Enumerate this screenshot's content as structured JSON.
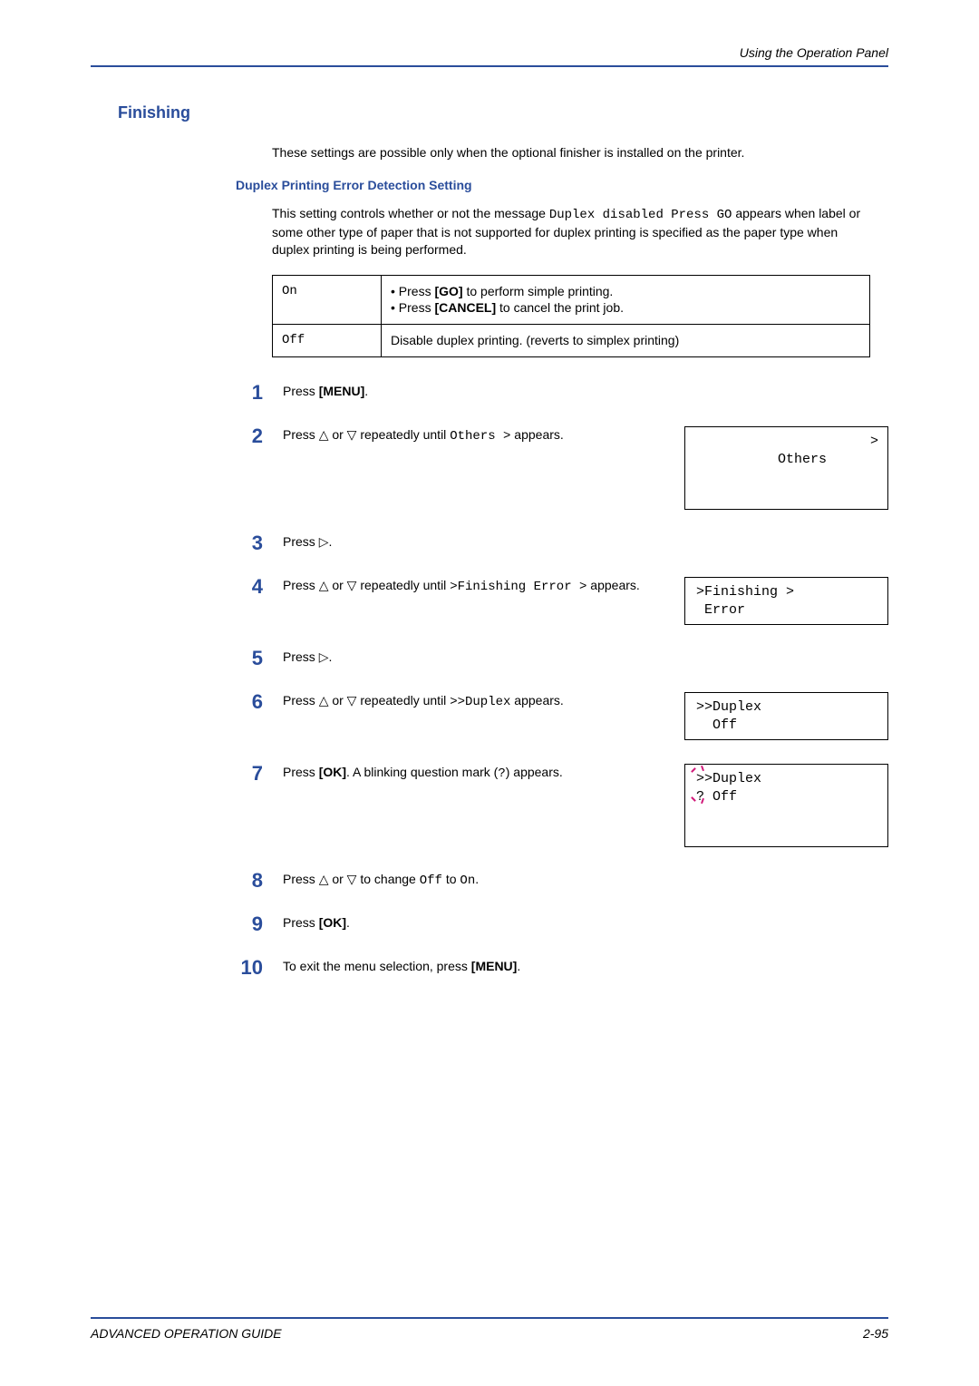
{
  "header": {
    "running": "Using the Operation Panel"
  },
  "title": "Finishing",
  "intro": "These settings are possible only when the optional finisher is installed on the printer.",
  "subsection": {
    "title": "Duplex Printing Error Detection Setting",
    "intro": {
      "pre": "This setting controls whether or not the message ",
      "code": "Duplex disabled Press GO",
      "post": " appears when label or some other type of paper that is not supported for duplex printing is specified as the paper type when duplex printing is being performed."
    }
  },
  "table": {
    "row1": {
      "key": "On",
      "b1": {
        "pre": "Press ",
        "bold": "[GO]",
        "post": " to perform simple printing."
      },
      "b2": {
        "pre": "Press ",
        "bold": "[CANCEL]",
        "post": " to cancel the print job."
      }
    },
    "row2": {
      "key": "Off",
      "text": "Disable duplex printing. (reverts to simplex printing)"
    }
  },
  "steps": {
    "s1": {
      "num": "1",
      "pre": "Press ",
      "bold": "[MENU]",
      "post": "."
    },
    "s2": {
      "num": "2",
      "pre": "Press ",
      "tri": "△ or ▽",
      "mid": " repeatedly until ",
      "code": "Others >",
      "post": " appears.",
      "lcd": {
        "line1": "Others",
        "arrow": ">"
      }
    },
    "s3": {
      "num": "3",
      "pre": "Press ",
      "tri": "▷",
      "post": "."
    },
    "s4": {
      "num": "4",
      "pre": "Press ",
      "tri": "△ or ▽",
      "mid": " repeatedly until ",
      "code": ">Finishing Error >",
      "post": " appears.",
      "lcd": {
        "line1": ">Finishing >",
        "line2": " Error"
      }
    },
    "s5": {
      "num": "5",
      "pre": "Press ",
      "tri": "▷",
      "post": "."
    },
    "s6": {
      "num": "6",
      "pre": "Press ",
      "tri": "△ or ▽",
      "mid": " repeatedly until ",
      "code": ">>Duplex",
      "post": " appears.",
      "lcd": {
        "line1": ">>Duplex",
        "line2": "  Off"
      }
    },
    "s7": {
      "num": "7",
      "pre": "Press ",
      "bold": "[OK]",
      "mid": ". A blinking question mark (",
      "code": "?",
      "post": ") appears.",
      "lcd": {
        "line1": ">>Duplex",
        "line2": "? Off"
      }
    },
    "s8": {
      "num": "8",
      "pre": "Press ",
      "tri": "△ or ▽",
      "mid": " to change ",
      "code1": "Off",
      "mid2": " to ",
      "code2": "On",
      "post": "."
    },
    "s9": {
      "num": "9",
      "pre": "Press ",
      "bold": "[OK]",
      "post": "."
    },
    "s10": {
      "num": "10",
      "pre": "To exit the menu selection, press ",
      "bold": "[MENU]",
      "post": "."
    }
  },
  "footer": {
    "left": "ADVANCED OPERATION GUIDE",
    "right": "2-95"
  }
}
